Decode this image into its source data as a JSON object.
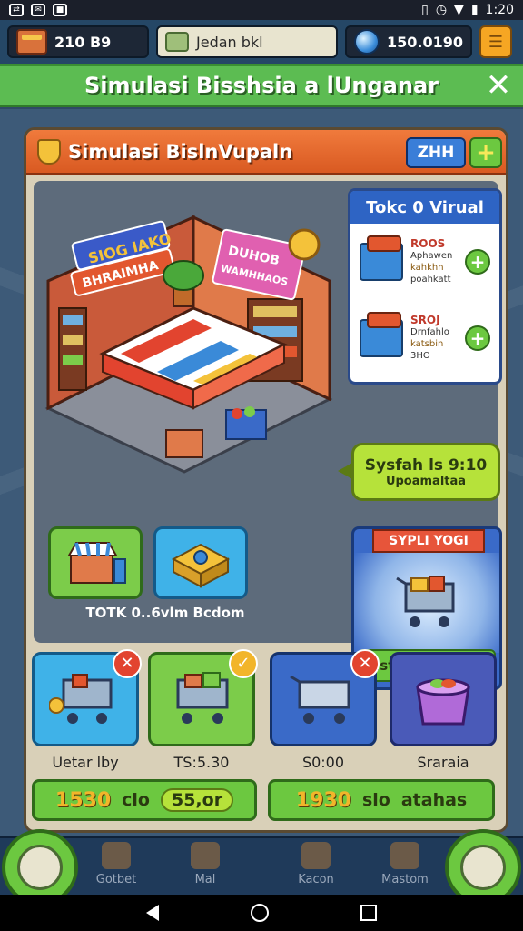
{
  "status_bar": {
    "time": "1:20"
  },
  "top_bar": {
    "coins": "210 B9",
    "user": "Jedan bkl",
    "gems": "150.0190"
  },
  "title_banner": {
    "title": "Simulasi Bisshsia a lUnganar"
  },
  "panel": {
    "title": "Simulasi BislnVupaln",
    "badge": "ZHH",
    "store_signs": [
      "SIOG IAKO",
      "BHRAIMHA",
      "DUHOB",
      "WAMHHAOS"
    ],
    "toko": {
      "title": "Tokc 0 Virual",
      "items": [
        {
          "code": "ROOS",
          "line1": "Aphawen",
          "line2": "kahkhn",
          "line3": "poahkatt"
        },
        {
          "code": "SROJ",
          "line1": "Drnfahlo",
          "line2": "katsbin",
          "line3": "3HO"
        }
      ]
    },
    "speech": {
      "line1": "Sysfah ls 9:10",
      "line2": "Upoamaltaa"
    },
    "upgrade": {
      "ribbon": "SYPLI YOGI",
      "button": "Sistem Upprode"
    },
    "tiles_label": "TOTK 0..6vlm Bcdom",
    "carts": [
      {
        "label": "Uetar lby",
        "badge": "✕"
      },
      {
        "label": "TS:5.30",
        "badge": "✓"
      },
      {
        "label": "S0:00",
        "badge": "✕"
      },
      {
        "label": "Sraraia",
        "badge": ""
      }
    ],
    "bottom_left": {
      "num": "1530",
      "text1": "clo",
      "text2": "55,or"
    },
    "bottom_right": {
      "num": "1930",
      "text1": "slo",
      "text2": "atahas"
    }
  },
  "nav": {
    "items": [
      "Gotbet",
      "Mal",
      "Kacon",
      "Mastom"
    ]
  },
  "colors": {
    "banner_green": "#5cbc52",
    "header_orange": "#e8692e",
    "accent_blue": "#2e64c4"
  }
}
